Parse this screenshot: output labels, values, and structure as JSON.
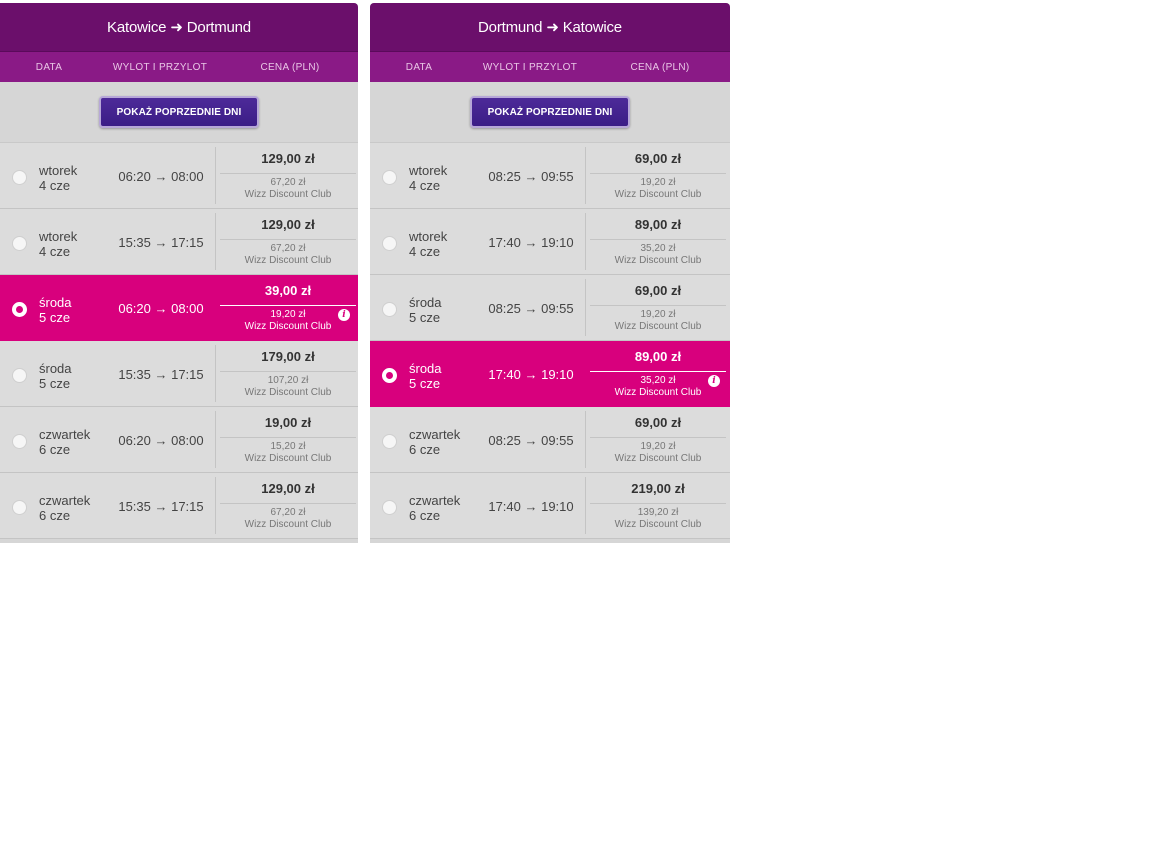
{
  "columns": {
    "date": "DATA",
    "time": "WYLOT I PRZYLOT",
    "price": "CENA (PLN)"
  },
  "prev_button_label": "POKAŻ POPRZEDNIE DNI",
  "colors": {
    "header": "#6b0f6b",
    "subheader": "#8a1a86",
    "selected": "#d8007d",
    "button": "#3b1d86"
  },
  "outbound": {
    "from": "Katowice",
    "arrow": "➜",
    "to": "Dortmund",
    "flights": [
      {
        "day": "wtorek",
        "date": "4 cze",
        "time": "06:20 → 08:00",
        "price": "129,00 zł",
        "club_price": "67,20 zł",
        "club_label": "Wizz Discount Club",
        "selected": false
      },
      {
        "day": "wtorek",
        "date": "4 cze",
        "time": "15:35 → 17:15",
        "price": "129,00 zł",
        "club_price": "67,20 zł",
        "club_label": "Wizz Discount Club",
        "selected": false
      },
      {
        "day": "środa",
        "date": "5 cze",
        "time": "06:20 → 08:00",
        "price": "39,00 zł",
        "club_price": "19,20 zł",
        "club_label": "Wizz Discount Club",
        "selected": true
      },
      {
        "day": "środa",
        "date": "5 cze",
        "time": "15:35 → 17:15",
        "price": "179,00 zł",
        "club_price": "107,20 zł",
        "club_label": "Wizz Discount Club",
        "selected": false
      },
      {
        "day": "czwartek",
        "date": "6 cze",
        "time": "06:20 → 08:00",
        "price": "19,00 zł",
        "club_price": "15,20 zł",
        "club_label": "Wizz Discount Club",
        "selected": false
      },
      {
        "day": "czwartek",
        "date": "6 cze",
        "time": "15:35 → 17:15",
        "price": "129,00 zł",
        "club_price": "67,20 zł",
        "club_label": "Wizz Discount Club",
        "selected": false
      }
    ]
  },
  "return": {
    "from": "Dortmund",
    "arrow": "➜",
    "to": "Katowice",
    "flights": [
      {
        "day": "wtorek",
        "date": "4 cze",
        "time": "08:25 → 09:55",
        "price": "69,00 zł",
        "club_price": "19,20 zł",
        "club_label": "Wizz Discount Club",
        "selected": false
      },
      {
        "day": "wtorek",
        "date": "4 cze",
        "time": "17:40 → 19:10",
        "price": "89,00 zł",
        "club_price": "35,20 zł",
        "club_label": "Wizz Discount Club",
        "selected": false
      },
      {
        "day": "środa",
        "date": "5 cze",
        "time": "08:25 → 09:55",
        "price": "69,00 zł",
        "club_price": "19,20 zł",
        "club_label": "Wizz Discount Club",
        "selected": false
      },
      {
        "day": "środa",
        "date": "5 cze",
        "time": "17:40 → 19:10",
        "price": "89,00 zł",
        "club_price": "35,20 zł",
        "club_label": "Wizz Discount Club",
        "selected": true
      },
      {
        "day": "czwartek",
        "date": "6 cze",
        "time": "08:25 → 09:55",
        "price": "69,00 zł",
        "club_price": "19,20 zł",
        "club_label": "Wizz Discount Club",
        "selected": false
      },
      {
        "day": "czwartek",
        "date": "6 cze",
        "time": "17:40 → 19:10",
        "price": "219,00 zł",
        "club_price": "139,20 zł",
        "club_label": "Wizz Discount Club",
        "selected": false
      }
    ]
  }
}
